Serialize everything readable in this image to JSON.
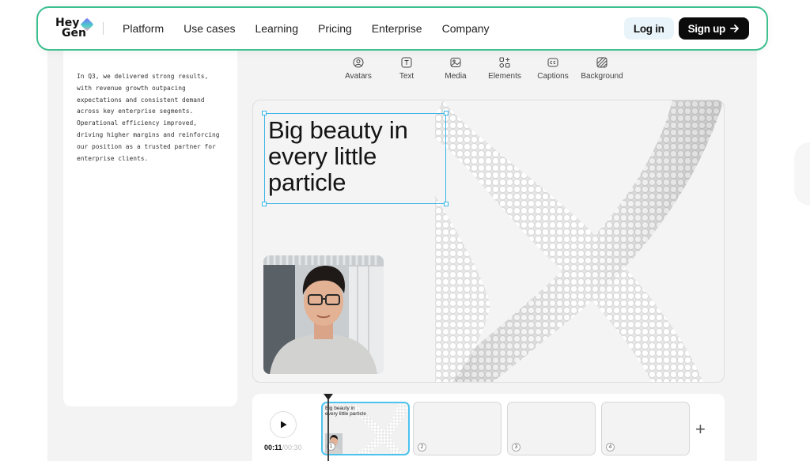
{
  "brand": {
    "line1": "Hey",
    "line2": "Gen"
  },
  "nav": {
    "links": [
      "Platform",
      "Use cases",
      "Learning",
      "Pricing",
      "Enterprise",
      "Company"
    ],
    "login": "Log in",
    "signup": "Sign up",
    "accent": "#3dbf8f"
  },
  "script": {
    "text": "In Q3, we delivered strong results, with revenue growth outpacing expectations and consistent demand across key enterprise segments. Operational efficiency improved, driving higher margins and reinforcing our position as a trusted partner for enterprise clients."
  },
  "toolbar": {
    "items": [
      {
        "label": "Avatars",
        "icon": "avatar-icon"
      },
      {
        "label": "Text",
        "icon": "text-icon"
      },
      {
        "label": "Media",
        "icon": "media-icon"
      },
      {
        "label": "Elements",
        "icon": "elements-icon"
      },
      {
        "label": "Captions",
        "icon": "captions-icon"
      },
      {
        "label": "Background",
        "icon": "background-icon"
      }
    ]
  },
  "canvas": {
    "headline": "Big beauty in every little particle",
    "selection_color": "#3ab5e6"
  },
  "timeline": {
    "current": "00:11",
    "total": "/00:30",
    "scenes": [
      {
        "number": "1",
        "title": "Big beauty in every little particle"
      },
      {
        "number": "2"
      },
      {
        "number": "3"
      },
      {
        "number": "4"
      }
    ],
    "add": "+"
  }
}
